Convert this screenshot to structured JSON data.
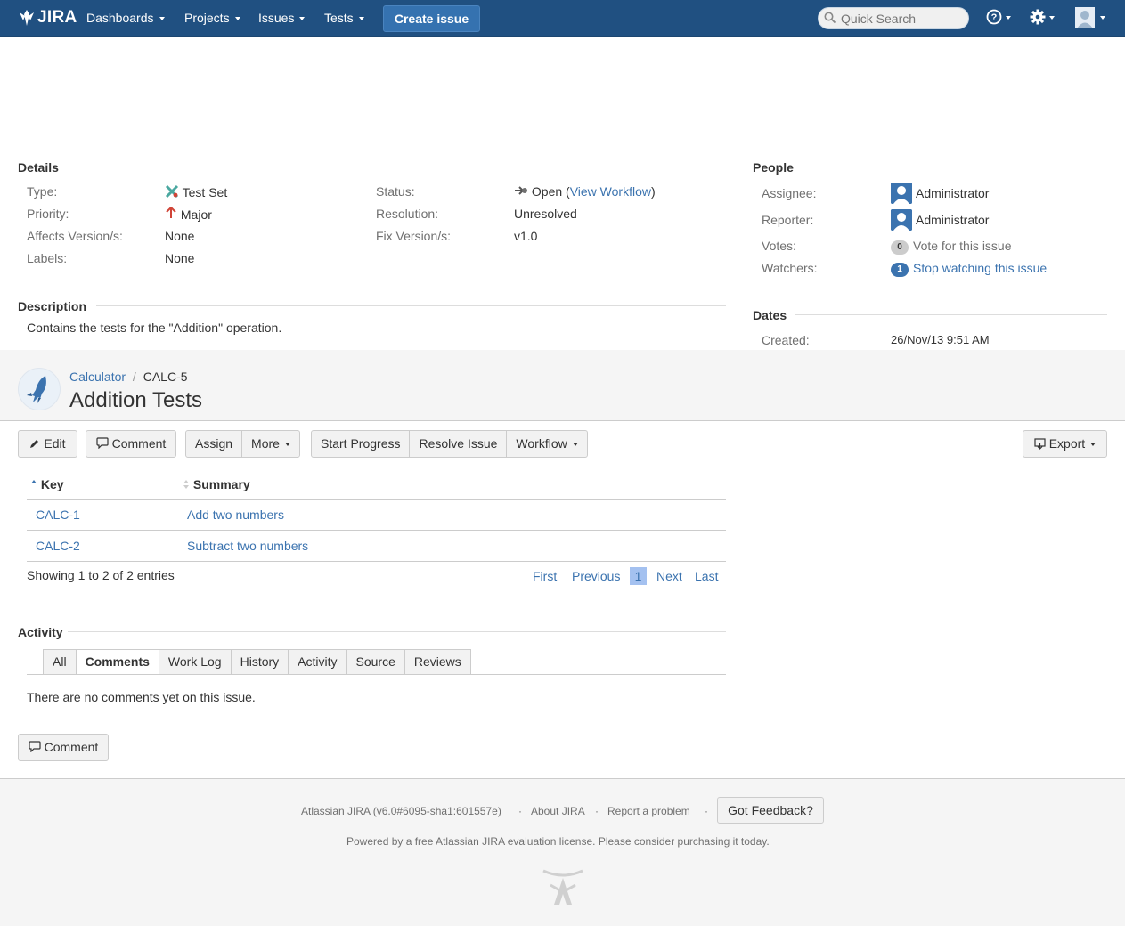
{
  "colors": {
    "nav_bg": "#205081",
    "link": "#3b73af",
    "create_btn": "#3572b0"
  },
  "nav": {
    "logo_text": "JIRA",
    "items": [
      "Dashboards",
      "Projects",
      "Issues",
      "Tests"
    ],
    "create_label": "Create issue",
    "search_placeholder": "Quick Search",
    "icons": [
      "help-icon",
      "gear-icon",
      "user-avatar-icon"
    ]
  },
  "details": {
    "heading": "Details",
    "type_label": "Type:",
    "type_value": "Test Set",
    "priority_label": "Priority:",
    "priority_value": "Major",
    "affects_label": "Affects Version/s:",
    "affects_value": "None",
    "labels_label": "Labels:",
    "labels_value": "None",
    "status_label": "Status:",
    "status_value": "Open",
    "status_open_paren": "(",
    "status_link": "View Workflow",
    "status_close_paren": ")",
    "resolution_label": "Resolution:",
    "resolution_value": "Unresolved",
    "fix_label": "Fix Version/s:",
    "fix_value": "v1.0"
  },
  "people": {
    "heading": "People",
    "assignee_label": "Assignee:",
    "assignee_value": "Administrator",
    "reporter_label": "Reporter:",
    "reporter_value": "Administrator",
    "votes_label": "Votes:",
    "votes_count": "0",
    "votes_link": "Vote for this issue",
    "watchers_label": "Watchers:",
    "watchers_count": "1",
    "watchers_link": "Stop watching this issue"
  },
  "description": {
    "heading": "Description",
    "text": "Contains the tests for the \"Addition\" operation."
  },
  "dates": {
    "heading": "Dates",
    "created_label": "Created:",
    "created_value": "26/Nov/13 9:51 AM"
  },
  "issue": {
    "project": "Calculator",
    "separator": "/",
    "key": "CALC-5",
    "title": "Addition Tests"
  },
  "toolbar": {
    "edit": "Edit",
    "comment": "Comment",
    "assign": "Assign",
    "more": "More",
    "start_progress": "Start Progress",
    "resolve": "Resolve Issue",
    "workflow": "Workflow",
    "export": "Export"
  },
  "tests_table": {
    "columns": [
      "Key",
      "Summary"
    ],
    "rows": [
      {
        "key": "CALC-1",
        "summary": "Add two numbers"
      },
      {
        "key": "CALC-2",
        "summary": "Subtract two numbers"
      }
    ],
    "info": "Showing 1 to 2 of 2 entries",
    "pager": {
      "first": "First",
      "previous": "Previous",
      "current": "1",
      "next": "Next",
      "last": "Last"
    }
  },
  "activity": {
    "heading": "Activity",
    "tabs": [
      "All",
      "Comments",
      "Work Log",
      "History",
      "Activity",
      "Source",
      "Reviews"
    ],
    "active_tab": "Comments",
    "empty_text": "There are no comments yet on this issue.",
    "comment_button": "Comment"
  },
  "footer": {
    "version": "Atlassian JIRA (v6.0#6095-sha1:601557e)",
    "dot": "·",
    "about": "About JIRA",
    "report": "Report a problem",
    "feedback": "Got Feedback?",
    "license": "Powered by a free Atlassian JIRA evaluation license. Please consider purchasing it today."
  }
}
